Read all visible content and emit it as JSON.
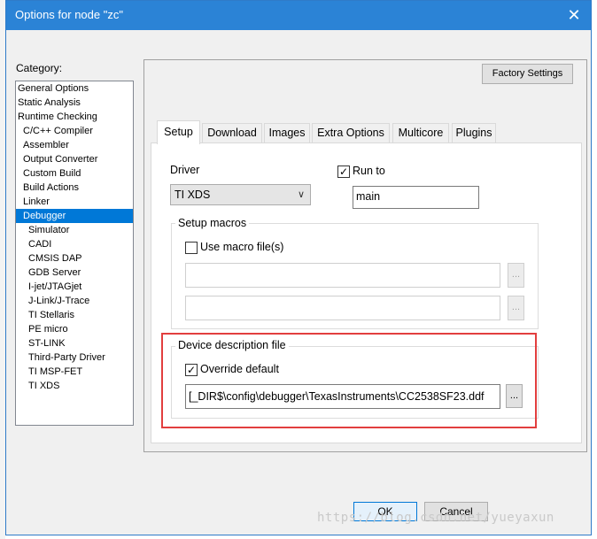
{
  "window": {
    "title": "Options for node \"zc\"",
    "close_glyph": "✕"
  },
  "category": {
    "label": "Category:",
    "items": [
      {
        "label": "General Options",
        "level": 0,
        "selected": false
      },
      {
        "label": "Static Analysis",
        "level": 0,
        "selected": false
      },
      {
        "label": "Runtime Checking",
        "level": 0,
        "selected": false
      },
      {
        "label": "C/C++ Compiler",
        "level": 1,
        "selected": false
      },
      {
        "label": "Assembler",
        "level": 1,
        "selected": false
      },
      {
        "label": "Output Converter",
        "level": 1,
        "selected": false
      },
      {
        "label": "Custom Build",
        "level": 1,
        "selected": false
      },
      {
        "label": "Build Actions",
        "level": 1,
        "selected": false
      },
      {
        "label": "Linker",
        "level": 1,
        "selected": false
      },
      {
        "label": "Debugger",
        "level": 1,
        "selected": true
      },
      {
        "label": "Simulator",
        "level": 2,
        "selected": false
      },
      {
        "label": "CADI",
        "level": 2,
        "selected": false
      },
      {
        "label": "CMSIS DAP",
        "level": 2,
        "selected": false
      },
      {
        "label": "GDB Server",
        "level": 2,
        "selected": false
      },
      {
        "label": "I-jet/JTAGjet",
        "level": 2,
        "selected": false
      },
      {
        "label": "J-Link/J-Trace",
        "level": 2,
        "selected": false
      },
      {
        "label": "TI Stellaris",
        "level": 2,
        "selected": false
      },
      {
        "label": "PE micro",
        "level": 2,
        "selected": false
      },
      {
        "label": "ST-LINK",
        "level": 2,
        "selected": false
      },
      {
        "label": "Third-Party Driver",
        "level": 2,
        "selected": false
      },
      {
        "label": "TI MSP-FET",
        "level": 2,
        "selected": false
      },
      {
        "label": "TI XDS",
        "level": 2,
        "selected": false
      }
    ]
  },
  "factory_settings_label": "Factory Settings",
  "tabs": [
    {
      "label": "Setup",
      "active": true
    },
    {
      "label": "Download",
      "active": false
    },
    {
      "label": "Images",
      "active": false
    },
    {
      "label": "Extra Options",
      "active": false
    },
    {
      "label": "Multicore",
      "active": false
    },
    {
      "label": "Plugins",
      "active": false
    }
  ],
  "setup": {
    "driver_label": "Driver",
    "driver_value": "TI XDS",
    "run_to_label": "Run to",
    "run_to_checked": true,
    "run_to_value": "main",
    "macros_legend": "Setup macros",
    "use_macro_label": "Use macro file(s)",
    "use_macro_checked": false,
    "macro_file_1": "",
    "macro_file_2": "",
    "device_legend": "Device description file",
    "override_label": "Override default",
    "override_checked": true,
    "device_file_value": "[_DIR$\\config\\debugger\\TexasInstruments\\CC2538SF23.ddf",
    "browse_label": "..."
  },
  "footer": {
    "ok_label": "OK",
    "cancel_label": "Cancel"
  },
  "watermark": "https://blog.csdn.net/yueyaxun",
  "colors": {
    "titlebar": "#2b83d6",
    "selection": "#0078d7",
    "highlight": "#e23e3e"
  }
}
